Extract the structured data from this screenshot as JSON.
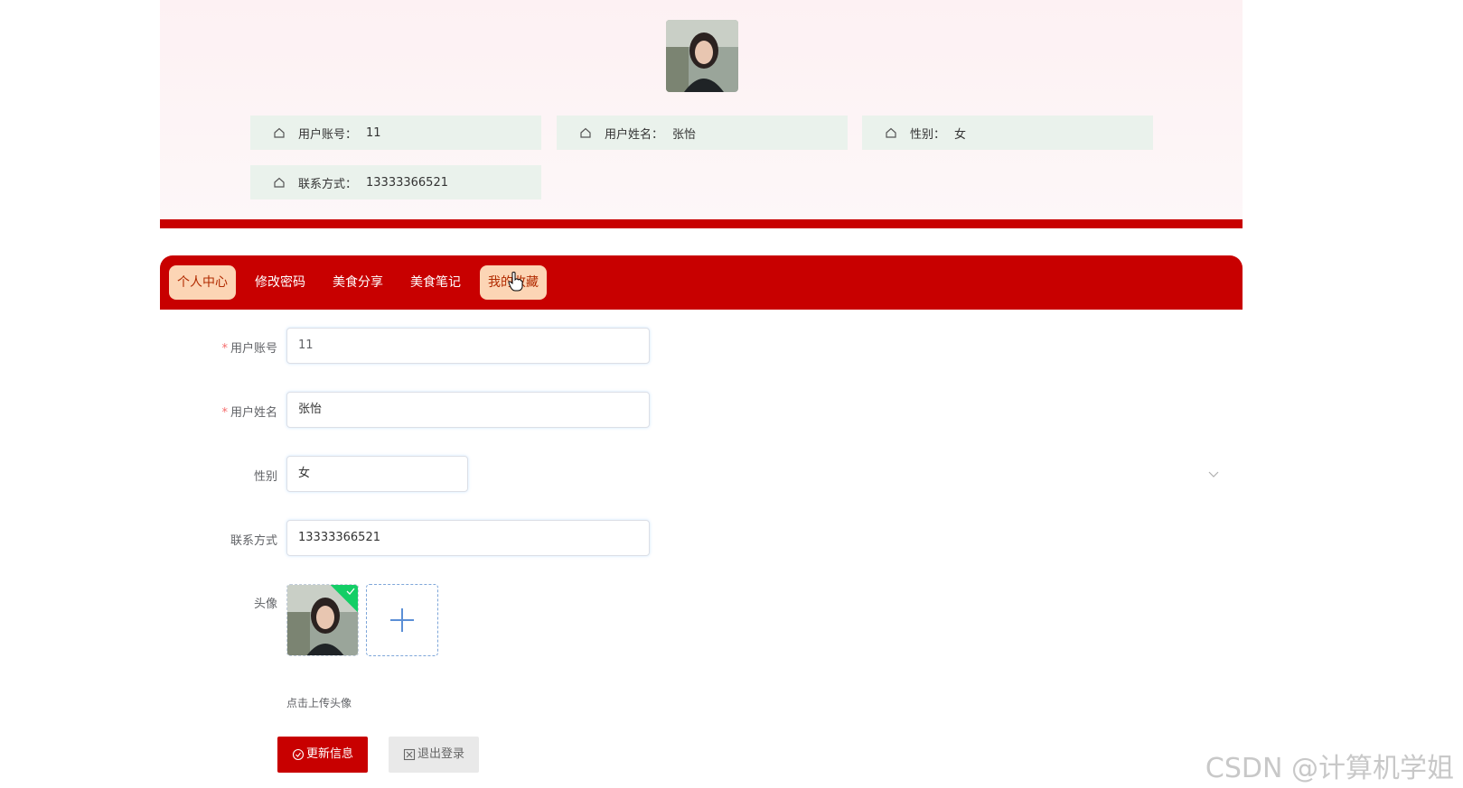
{
  "profile": {
    "fields": [
      {
        "label": "用户账号：",
        "value": "11"
      },
      {
        "label": "用户姓名：",
        "value": "张怡"
      },
      {
        "label": "性别：",
        "value": "女"
      },
      {
        "label": "联系方式：",
        "value": "13333366521"
      }
    ]
  },
  "nav": {
    "tabs": [
      "个人中心",
      "修改密码",
      "美食分享",
      "美食笔记",
      "我的收藏"
    ]
  },
  "form": {
    "account": {
      "label": "用户账号",
      "value": "11"
    },
    "name": {
      "label": "用户姓名",
      "value": "张怡"
    },
    "gender": {
      "label": "性别",
      "value": "女"
    },
    "phone": {
      "label": "联系方式",
      "value": "13333366521"
    },
    "avatar": {
      "label": "头像",
      "hint": "点击上传头像"
    },
    "required_mark": "*"
  },
  "buttons": {
    "update": "更新信息",
    "logout": "退出登录"
  },
  "watermark": "CSDN @计算机学姐",
  "colors": {
    "primary": "#c80000",
    "active_tab_bg": "#fcd5b5",
    "info_card_bg": "#eaf2ec",
    "success": "#13ce66"
  },
  "icons": [
    "home-icon",
    "check-circle-icon",
    "close-square-icon",
    "plus-icon",
    "chevron-down-icon",
    "check-icon",
    "hand-cursor-icon"
  ]
}
